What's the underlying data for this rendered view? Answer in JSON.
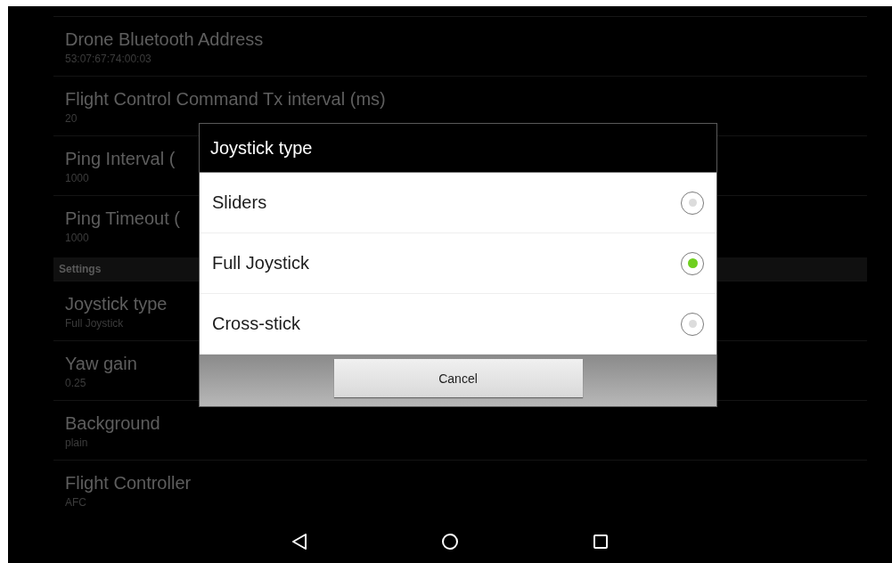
{
  "preferences": [
    {
      "kind": "item",
      "title": "Drone Bluetooth Address",
      "summary": "53:07:67:74:00:03"
    },
    {
      "kind": "item",
      "title": "Flight Control Command Tx interval (ms)",
      "summary": "20"
    },
    {
      "kind": "item",
      "title": "Ping Interval (",
      "summary": "1000"
    },
    {
      "kind": "item",
      "title": "Ping Timeout (",
      "summary": "1000"
    },
    {
      "kind": "category",
      "title": "Settings"
    },
    {
      "kind": "item",
      "title": "Joystick type",
      "summary": "Full Joystick"
    },
    {
      "kind": "item",
      "title": "Yaw gain",
      "summary": "0.25"
    },
    {
      "kind": "item",
      "title": "Background",
      "summary": "plain"
    },
    {
      "kind": "item",
      "title": "Flight Controller",
      "summary": "AFC"
    }
  ],
  "dialog": {
    "title": "Joystick type",
    "options": [
      {
        "label": "Sliders",
        "selected": false
      },
      {
        "label": "Full Joystick",
        "selected": true
      },
      {
        "label": "Cross-stick",
        "selected": false
      }
    ],
    "buttons": [
      "Cancel"
    ]
  }
}
